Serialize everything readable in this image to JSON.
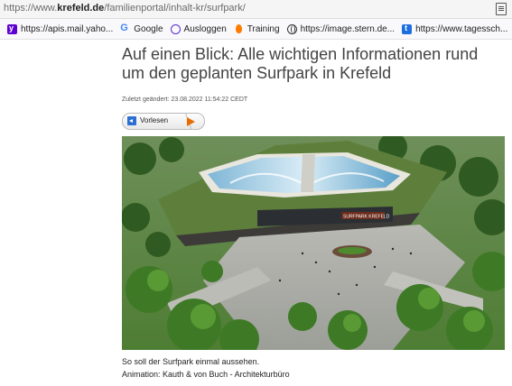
{
  "browser": {
    "url_prefix": "https://www.",
    "url_domain": "krefeld.de",
    "url_path": "/familienportal/inhalt-kr/surfpark/",
    "bookmarks": [
      {
        "label": "https://apis.mail.yaho...",
        "icon": "yahoo-icon"
      },
      {
        "label": "Google",
        "icon": "google-icon"
      },
      {
        "label": "Ausloggen",
        "icon": "logout-icon"
      },
      {
        "label": "Training",
        "icon": "fire-icon"
      },
      {
        "label": "https://image.stern.de...",
        "icon": "globe-icon"
      },
      {
        "label": "https://www.tagessch...",
        "icon": "tagesschau-icon"
      }
    ]
  },
  "article": {
    "title": "Auf einen Blick: Alle wichtigen Informationen rund um den geplanten Surfpark in Krefeld",
    "updated": "Zuletzt geändert: 23.08.2022 11:54:22 CEDT",
    "listen_label": "Vorlesen",
    "caption_line1": "So soll der Surfpark einmal aussehen.",
    "caption_line2": "Animation: Kauth & von Buch - Architekturbüro",
    "sign_text": "SURFPARK KREFELD"
  },
  "colors": {
    "accent_play": "#e86b00",
    "speaker": "#2b6fd3"
  }
}
